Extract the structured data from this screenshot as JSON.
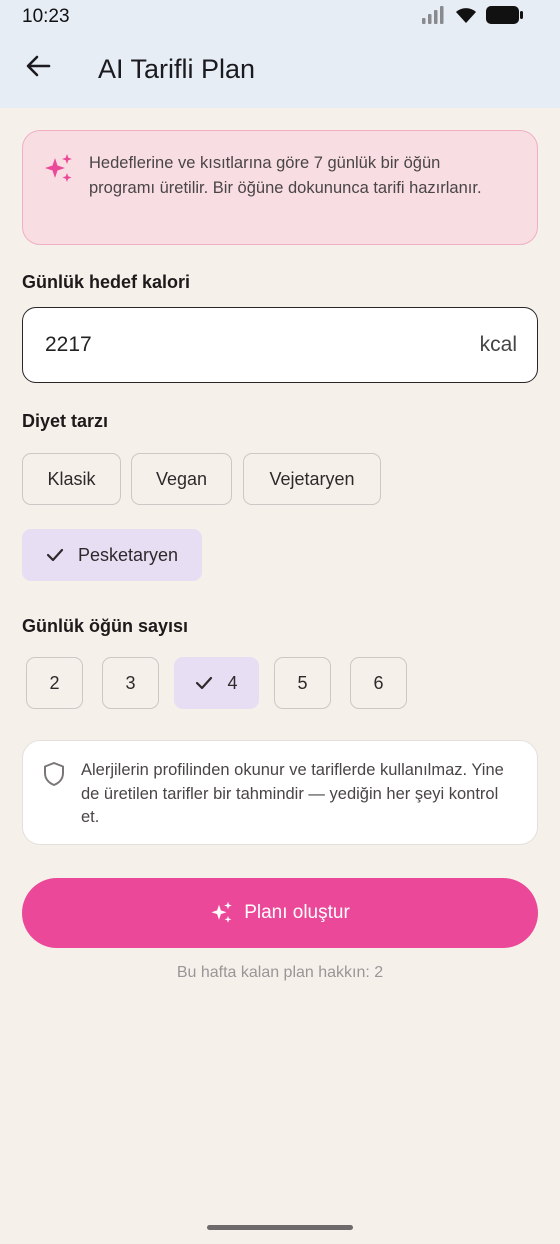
{
  "status": {
    "time": "10:23"
  },
  "header": {
    "title": "AI Tarifli Plan"
  },
  "info": {
    "text": "Hedeflerine ve kısıtlarına göre 7 günlük bir öğün programı üretilir. Bir öğüne dokununca tarifi hazırlanır."
  },
  "calories": {
    "label": "Günlük hedef kalori",
    "value": "2217",
    "unit": "kcal"
  },
  "diet": {
    "label": "Diyet tarzı",
    "options": [
      "Klasik",
      "Vegan",
      "Vejetaryen",
      "Pesketaryen"
    ],
    "selected": "Pesketaryen"
  },
  "meals": {
    "label": "Günlük öğün sayısı",
    "options": [
      "2",
      "3",
      "4",
      "5",
      "6"
    ],
    "selected": "4"
  },
  "note": {
    "text": "Alerjilerin profilinden okunur ve tariflerde kullanılmaz. Yine de üretilen tarifler bir tahmindir — yediğin her şeyi kontrol et."
  },
  "action": {
    "label": "Planı oluştur"
  },
  "quota": {
    "text": "Bu hafta kalan plan hakkın: 2"
  },
  "colors": {
    "accent": "#EC4899",
    "selected_chip": "#E7DEF3",
    "info_bg": "#F8DDE2",
    "background": "#F5F1EA"
  },
  "icons": {
    "back": "arrow-left-icon",
    "sparkle": "sparkle-icon",
    "shield": "shield-icon",
    "check": "check-icon",
    "signal": "signal-icon",
    "wifi": "wifi-icon",
    "battery": "battery-icon"
  }
}
